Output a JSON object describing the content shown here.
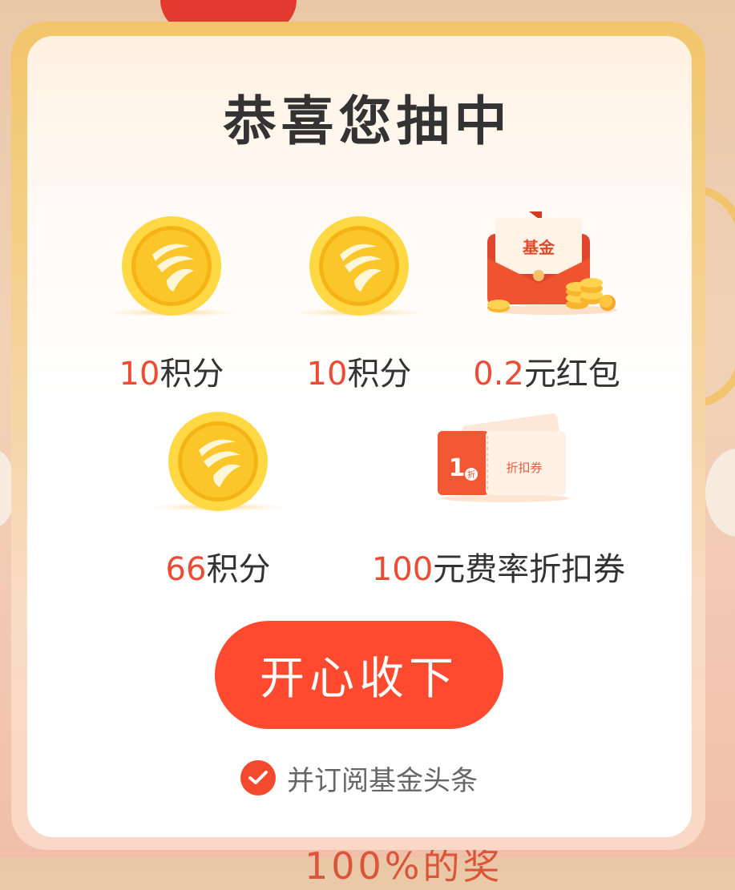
{
  "modal": {
    "title": "恭喜您抽中",
    "prizes": [
      {
        "icon": "coin-icon",
        "amount": "10",
        "unit": "积分"
      },
      {
        "icon": "coin-icon",
        "amount": "10",
        "unit": "积分"
      },
      {
        "icon": "red-envelope-icon",
        "envelope_text": "基金",
        "amount": "0.2",
        "unit": "元红包"
      },
      {
        "icon": "coin-icon",
        "amount": "66",
        "unit": "积分"
      },
      {
        "icon": "discount-coupon-icon",
        "coupon_badge": "1",
        "coupon_badge_sub": "折",
        "coupon_text": "折扣券",
        "amount": "100",
        "unit": "元费率折扣券"
      }
    ],
    "accept_button": "开心收下",
    "subscribe": {
      "checked": true,
      "label": "并订阅基金头条"
    }
  },
  "background": {
    "partial_text": "100%的奖"
  },
  "colors": {
    "accent": "#ff4a30",
    "amount": "#ec4b34",
    "title": "#333333",
    "border": "#f2c56a"
  }
}
